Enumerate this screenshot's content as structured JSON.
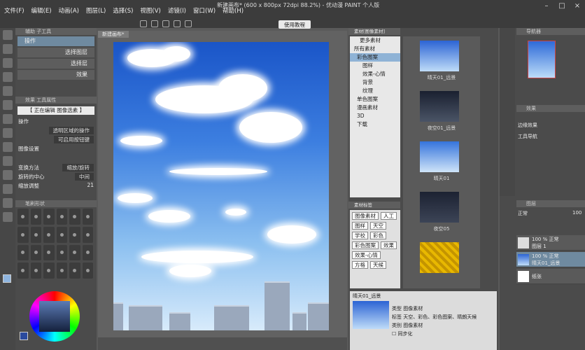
{
  "window": {
    "title": "新建画布* (600 x 800px 72dpi 88.2%) - 优动漫 PAINT 个人版"
  },
  "menu": [
    "文件(F)",
    "编辑(E)",
    "动画(A)",
    "图层(L)",
    "选择(S)",
    "视图(V)",
    "滤镜(I)",
    "窗口(W)",
    "帮助(H)"
  ],
  "toolbar": {
    "tutorial_label": "使用教程"
  },
  "canvas": {
    "tab_label": "新建画布*"
  },
  "left_panel": {
    "subtool_header": "辅助 子工具",
    "subtools": [
      "操作",
      "选择图层",
      "选择层",
      "效果"
    ],
    "props_header": "效果 工具属性",
    "props_title": "【 正在编辑 图像选素 】",
    "labels": {
      "op": "操作",
      "op_value": "透明区域的操作",
      "op_value2": "可启用按钮键",
      "img_settings": "图像设置",
      "transform": "变换方法",
      "transform_value": "缩放/旋转",
      "center": "旋转的中心",
      "center_value": "中间",
      "scale": "缩放调整",
      "scale_value": "21"
    },
    "brush_header": "笔刷形状"
  },
  "material_panel": {
    "tree_header": "素材[图像素材]",
    "more_label": "更多素材",
    "tree": [
      "所有素材",
      "彩色图案",
      "图样",
      "效果-心情",
      "背景",
      "纹理",
      "单色图案",
      "漫画素材",
      "3D",
      "下载"
    ],
    "tags_header": "素材标签",
    "tags": [
      "图像素材",
      "人工",
      "图样",
      "天空",
      "学校",
      "彩色",
      "彩色图案",
      "效果",
      "效果-心情",
      "方格",
      "天候"
    ],
    "thumbnails": [
      "晴天01_远景",
      "夜空01_远景",
      "晴天01",
      "夜空05",
      ""
    ],
    "detail": {
      "name": "晴天01_远景",
      "type_label": "类型",
      "type_value": "图像素材",
      "tags_label": "标签",
      "tags_value": "天空、彩色、彩色图案、晴朗天候",
      "category_label": "类别",
      "category_value": "图像素材",
      "checkbox": "同步化"
    }
  },
  "right_panel": {
    "nav_header": "导航器",
    "props_header": "效果",
    "fx_label": "边缘效果",
    "fx_label2": "工具导航",
    "layers_header": "图层",
    "blend": "正常",
    "opacity": "100",
    "layers": [
      {
        "name": "100 % 正常",
        "sub": "图层 1"
      },
      {
        "name": "100 % 正常",
        "sub": "晴天01_远景"
      },
      {
        "name": "",
        "sub": "纸张"
      }
    ]
  },
  "colors": {
    "accent": "#6f8aa0",
    "panel": "#4b4b4b",
    "menubar": "#3c3c3c"
  }
}
